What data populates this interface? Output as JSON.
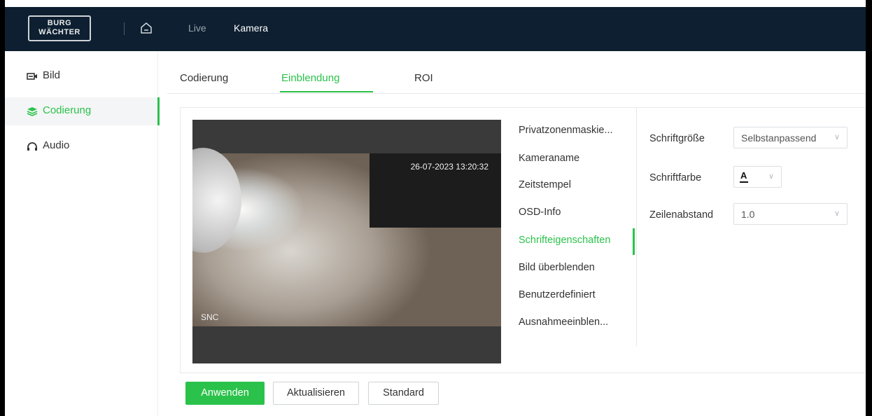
{
  "topbar": {
    "logo_line1": "BURG",
    "logo_line2": "WÄCHTER",
    "nav_live": "Live",
    "nav_kamera": "Kamera"
  },
  "sidebar": {
    "items": [
      {
        "label": "Bild",
        "icon": "video-camera-icon"
      },
      {
        "label": "Codierung",
        "icon": "layers-icon",
        "active": true
      },
      {
        "label": "Audio",
        "icon": "headphones-icon"
      }
    ]
  },
  "tabs": [
    {
      "label": "Codierung"
    },
    {
      "label": "Einblendung",
      "active": true
    },
    {
      "label": "ROI"
    }
  ],
  "preview": {
    "timestamp": "26-07-2023 13:20:32",
    "channel_name": "SNC"
  },
  "overlay_menu": {
    "items": [
      "Privatzonenmaskie...",
      "Kameraname",
      "Zeitstempel",
      "OSD-Info",
      "Schrifteigenschaften",
      "Bild überblenden",
      "Benutzerdefiniert",
      "Ausnahmeeinblen..."
    ],
    "active": "Schrifteigenschaften"
  },
  "form": {
    "font_size_label": "Schriftgröße",
    "font_size_value": "Selbstanpassend",
    "font_color_label": "Schriftfarbe",
    "font_color_value": "A",
    "line_spacing_label": "Zeilenabstand",
    "line_spacing_value": "1.0"
  },
  "buttons": {
    "apply": "Anwenden",
    "refresh": "Aktualisieren",
    "default": "Standard"
  },
  "colors": {
    "accent": "#2bc24b",
    "topbar": "#0d1f30"
  }
}
